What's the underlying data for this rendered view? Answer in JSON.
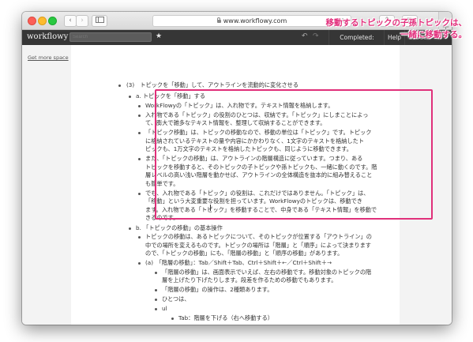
{
  "browser": {
    "url": "www.workflowy.com"
  },
  "app": {
    "logo": "workflowy",
    "search_placeholder": "Search",
    "completed_label": "Completed: Visible",
    "help_label": "Help",
    "saved_label": "Saved"
  },
  "sidebar": {
    "get_more_space": "Get more space"
  },
  "annotation": {
    "line1": "移動するトピックの子孫トピックは、",
    "line2": "一緒に移動する。"
  },
  "outline": {
    "heading": "(3)　トピックを「移動」して、アウトラインを流動的に変化させる",
    "a_title": "a.  トピックを「移動」する",
    "a_items": [
      [
        "WorkFlowyの「トピック」は、入れ物です。テキスト情報を格納します。"
      ],
      [
        "入れ物である「トピック」の役割のひとつは、収納です。「トピック」にしまことによっ",
        "て、膨大で雑多なテキスト情報を、整理して収納することができます。"
      ],
      [
        "「トピック移動」は、トピックの移動なので、移動の単位は「トピック」です。トピック",
        "に格納されているテキストの量や内容にかかわりなく、1文字のテキストを格納したト",
        "ピックも、1万文字のテキストを格納したトピックも、同じように移動できます。"
      ],
      [
        "また、「トピックの移動」は、アウトラインの階層構造に従っています。つまり、ある",
        "トピックを移動すると、そのトピックの子トピックや孫トピックも、一緒に動くのです。階",
        "層レベルの高い浅い階層を動かせば、アウトラインの全体構造を抜本的に組み替えること",
        "も簡単です。"
      ],
      [
        "でも、入れ物である「トピック」の役割は、これだけではありません。「トピック」は、",
        "「移動」という大変重要な役割を担っています。WorkFlowyのトピックは、移動でき",
        "ます。入れ物である「トピック」を移動することで、中身である「テキスト情報」を移動で",
        "きるのです。"
      ]
    ],
    "b_title": "b.  「トピックの移動」の基本操作",
    "b_item": [
      "トピックの移動は、あるトピックについて、そのトピックが位置する「アウトライン」の",
      "中での場所を変えるものです。トピックの場所は「階層」と「順序」によって決まります",
      "ので、「トピックの移動」にも、「階層の移動」と「順序の移動」があります。"
    ],
    "a2_title": "(a)　「階層の移動」：Tab／Shift＋Tab、Ctrl＋Shift＋←／Ctrl＋Shift＋→",
    "a2_items": [
      [
        "「階層の移動」は、画面表示でいえば、左右の移動です。移動対象のトピックの階",
        "層を上げたり下げたりします。段差を作るための移動でもあります。"
      ],
      [
        "「階層の移動」の操作は、2種類あります。"
      ],
      [
        "ひとつは、"
      ],
      [
        "ul"
      ]
    ],
    "tab_item": "Tab：階層を下げる（右へ移動する）"
  }
}
